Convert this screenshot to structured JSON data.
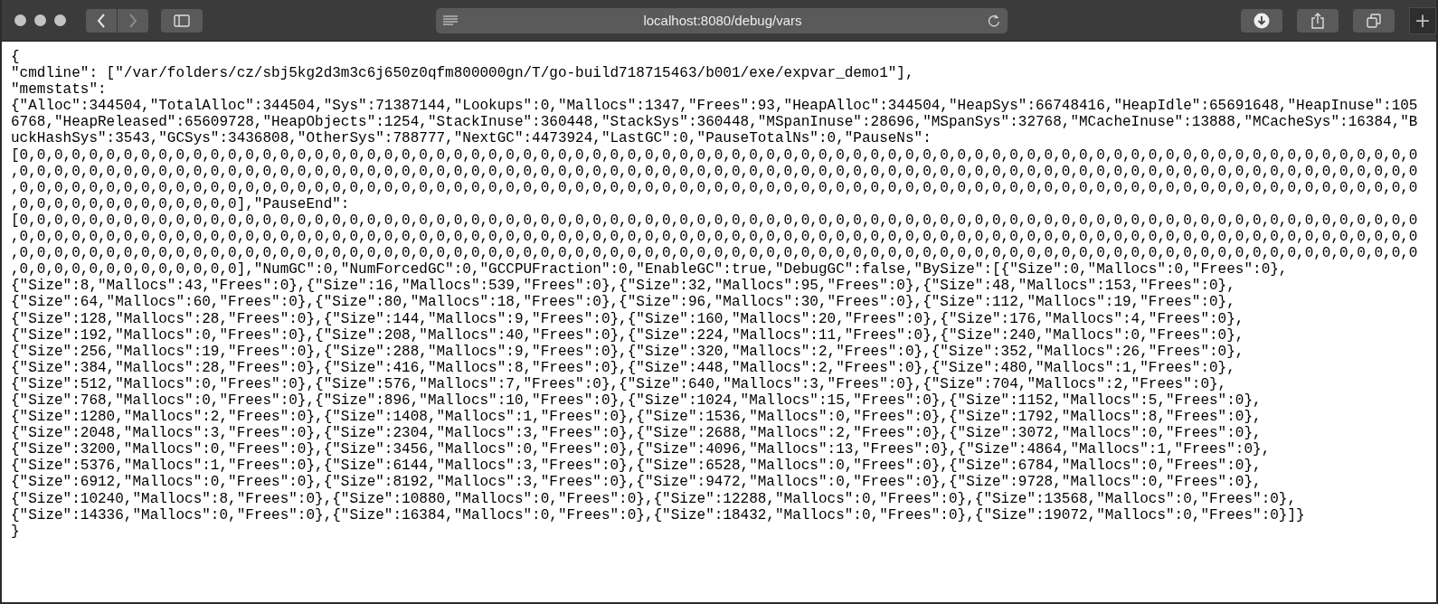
{
  "browser": {
    "url": "localhost:8080/debug/vars",
    "back_disabled": false,
    "forward_disabled": true,
    "new_tab_label": "+"
  },
  "page": {
    "lines": [
      "{",
      "\"cmdline\": [\"/var/folders/cz/sbj5kg2d3m3c6j650z0qfm800000gn/T/go-build718715463/b001/exe/expvar_demo1\"],",
      "\"memstats\":",
      "{\"Alloc\":344504,\"TotalAlloc\":344504,\"Sys\":71387144,\"Lookups\":0,\"Mallocs\":1347,\"Frees\":93,\"HeapAlloc\":344504,\"HeapSys\":66748416,\"HeapIdle\":65691648,\"HeapInuse\":105",
      "6768,\"HeapReleased\":65609728,\"HeapObjects\":1254,\"StackInuse\":360448,\"StackSys\":360448,\"MSpanInuse\":28696,\"MSpanSys\":32768,\"MCacheInuse\":13888,\"MCacheSys\":16384,\"B",
      "uckHashSys\":3543,\"GCSys\":3436808,\"OtherSys\":788777,\"NextGC\":4473924,\"LastGC\":0,\"PauseTotalNs\":0,\"PauseNs\":",
      "[0,0,0,0,0,0,0,0,0,0,0,0,0,0,0,0,0,0,0,0,0,0,0,0,0,0,0,0,0,0,0,0,0,0,0,0,0,0,0,0,0,0,0,0,0,0,0,0,0,0,0,0,0,0,0,0,0,0,0,0,0,0,0,0,0,0,0,0,0,0,0,0,0,0,0,0,0,0,0,0,0",
      ",0,0,0,0,0,0,0,0,0,0,0,0,0,0,0,0,0,0,0,0,0,0,0,0,0,0,0,0,0,0,0,0,0,0,0,0,0,0,0,0,0,0,0,0,0,0,0,0,0,0,0,0,0,0,0,0,0,0,0,0,0,0,0,0,0,0,0,0,0,0,0,0,0,0,0,0,0,0,0,0,0",
      ",0,0,0,0,0,0,0,0,0,0,0,0,0,0,0,0,0,0,0,0,0,0,0,0,0,0,0,0,0,0,0,0,0,0,0,0,0,0,0,0,0,0,0,0,0,0,0,0,0,0,0,0,0,0,0,0,0,0,0,0,0,0,0,0,0,0,0,0,0,0,0,0,0,0,0,0,0,0,0,0,0",
      ",0,0,0,0,0,0,0,0,0,0,0,0,0],\"PauseEnd\":",
      "[0,0,0,0,0,0,0,0,0,0,0,0,0,0,0,0,0,0,0,0,0,0,0,0,0,0,0,0,0,0,0,0,0,0,0,0,0,0,0,0,0,0,0,0,0,0,0,0,0,0,0,0,0,0,0,0,0,0,0,0,0,0,0,0,0,0,0,0,0,0,0,0,0,0,0,0,0,0,0,0,0",
      ",0,0,0,0,0,0,0,0,0,0,0,0,0,0,0,0,0,0,0,0,0,0,0,0,0,0,0,0,0,0,0,0,0,0,0,0,0,0,0,0,0,0,0,0,0,0,0,0,0,0,0,0,0,0,0,0,0,0,0,0,0,0,0,0,0,0,0,0,0,0,0,0,0,0,0,0,0,0,0,0,0",
      ",0,0,0,0,0,0,0,0,0,0,0,0,0,0,0,0,0,0,0,0,0,0,0,0,0,0,0,0,0,0,0,0,0,0,0,0,0,0,0,0,0,0,0,0,0,0,0,0,0,0,0,0,0,0,0,0,0,0,0,0,0,0,0,0,0,0,0,0,0,0,0,0,0,0,0,0,0,0,0,0,0",
      ",0,0,0,0,0,0,0,0,0,0,0,0,0],\"NumGC\":0,\"NumForcedGC\":0,\"GCCPUFraction\":0,\"EnableGC\":true,\"DebugGC\":false,\"BySize\":[{\"Size\":0,\"Mallocs\":0,\"Frees\":0},",
      "{\"Size\":8,\"Mallocs\":43,\"Frees\":0},{\"Size\":16,\"Mallocs\":539,\"Frees\":0},{\"Size\":32,\"Mallocs\":95,\"Frees\":0},{\"Size\":48,\"Mallocs\":153,\"Frees\":0},",
      "{\"Size\":64,\"Mallocs\":60,\"Frees\":0},{\"Size\":80,\"Mallocs\":18,\"Frees\":0},{\"Size\":96,\"Mallocs\":30,\"Frees\":0},{\"Size\":112,\"Mallocs\":19,\"Frees\":0},",
      "{\"Size\":128,\"Mallocs\":28,\"Frees\":0},{\"Size\":144,\"Mallocs\":9,\"Frees\":0},{\"Size\":160,\"Mallocs\":20,\"Frees\":0},{\"Size\":176,\"Mallocs\":4,\"Frees\":0},",
      "{\"Size\":192,\"Mallocs\":0,\"Frees\":0},{\"Size\":208,\"Mallocs\":40,\"Frees\":0},{\"Size\":224,\"Mallocs\":11,\"Frees\":0},{\"Size\":240,\"Mallocs\":0,\"Frees\":0},",
      "{\"Size\":256,\"Mallocs\":19,\"Frees\":0},{\"Size\":288,\"Mallocs\":9,\"Frees\":0},{\"Size\":320,\"Mallocs\":2,\"Frees\":0},{\"Size\":352,\"Mallocs\":26,\"Frees\":0},",
      "{\"Size\":384,\"Mallocs\":28,\"Frees\":0},{\"Size\":416,\"Mallocs\":8,\"Frees\":0},{\"Size\":448,\"Mallocs\":2,\"Frees\":0},{\"Size\":480,\"Mallocs\":1,\"Frees\":0},",
      "{\"Size\":512,\"Mallocs\":0,\"Frees\":0},{\"Size\":576,\"Mallocs\":7,\"Frees\":0},{\"Size\":640,\"Mallocs\":3,\"Frees\":0},{\"Size\":704,\"Mallocs\":2,\"Frees\":0},",
      "{\"Size\":768,\"Mallocs\":0,\"Frees\":0},{\"Size\":896,\"Mallocs\":10,\"Frees\":0},{\"Size\":1024,\"Mallocs\":15,\"Frees\":0},{\"Size\":1152,\"Mallocs\":5,\"Frees\":0},",
      "{\"Size\":1280,\"Mallocs\":2,\"Frees\":0},{\"Size\":1408,\"Mallocs\":1,\"Frees\":0},{\"Size\":1536,\"Mallocs\":0,\"Frees\":0},{\"Size\":1792,\"Mallocs\":8,\"Frees\":0},",
      "{\"Size\":2048,\"Mallocs\":3,\"Frees\":0},{\"Size\":2304,\"Mallocs\":3,\"Frees\":0},{\"Size\":2688,\"Mallocs\":2,\"Frees\":0},{\"Size\":3072,\"Mallocs\":0,\"Frees\":0},",
      "{\"Size\":3200,\"Mallocs\":0,\"Frees\":0},{\"Size\":3456,\"Mallocs\":0,\"Frees\":0},{\"Size\":4096,\"Mallocs\":13,\"Frees\":0},{\"Size\":4864,\"Mallocs\":1,\"Frees\":0},",
      "{\"Size\":5376,\"Mallocs\":1,\"Frees\":0},{\"Size\":6144,\"Mallocs\":3,\"Frees\":0},{\"Size\":6528,\"Mallocs\":0,\"Frees\":0},{\"Size\":6784,\"Mallocs\":0,\"Frees\":0},",
      "{\"Size\":6912,\"Mallocs\":0,\"Frees\":0},{\"Size\":8192,\"Mallocs\":3,\"Frees\":0},{\"Size\":9472,\"Mallocs\":0,\"Frees\":0},{\"Size\":9728,\"Mallocs\":0,\"Frees\":0},",
      "{\"Size\":10240,\"Mallocs\":8,\"Frees\":0},{\"Size\":10880,\"Mallocs\":0,\"Frees\":0},{\"Size\":12288,\"Mallocs\":0,\"Frees\":0},{\"Size\":13568,\"Mallocs\":0,\"Frees\":0},",
      "{\"Size\":14336,\"Mallocs\":0,\"Frees\":0},{\"Size\":16384,\"Mallocs\":0,\"Frees\":0},{\"Size\":18432,\"Mallocs\":0,\"Frees\":0},{\"Size\":19072,\"Mallocs\":0,\"Frees\":0}]}",
      "}"
    ]
  }
}
